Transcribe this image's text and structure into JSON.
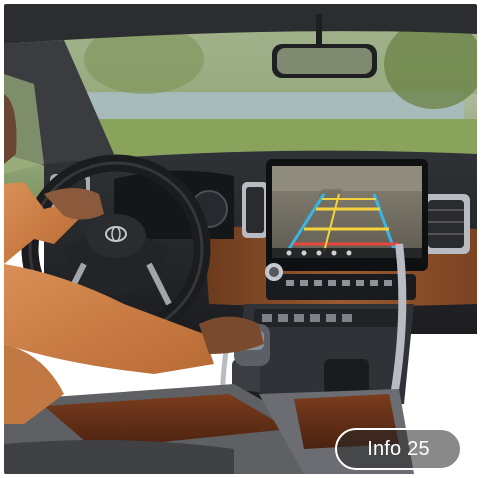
{
  "photo": {
    "subject": "truck-interior-backup-camera",
    "brand_logo": "Toyota"
  },
  "screen": {
    "view": "backup-camera",
    "guide_line_colors": [
      "#f4d23c",
      "#38b6e8",
      "#e8453c"
    ]
  },
  "info_button": {
    "label": "Info 25"
  },
  "colors": {
    "leather": "#8a4f2a",
    "dash": "#2a2c30",
    "trim": "#b8bcc2"
  }
}
